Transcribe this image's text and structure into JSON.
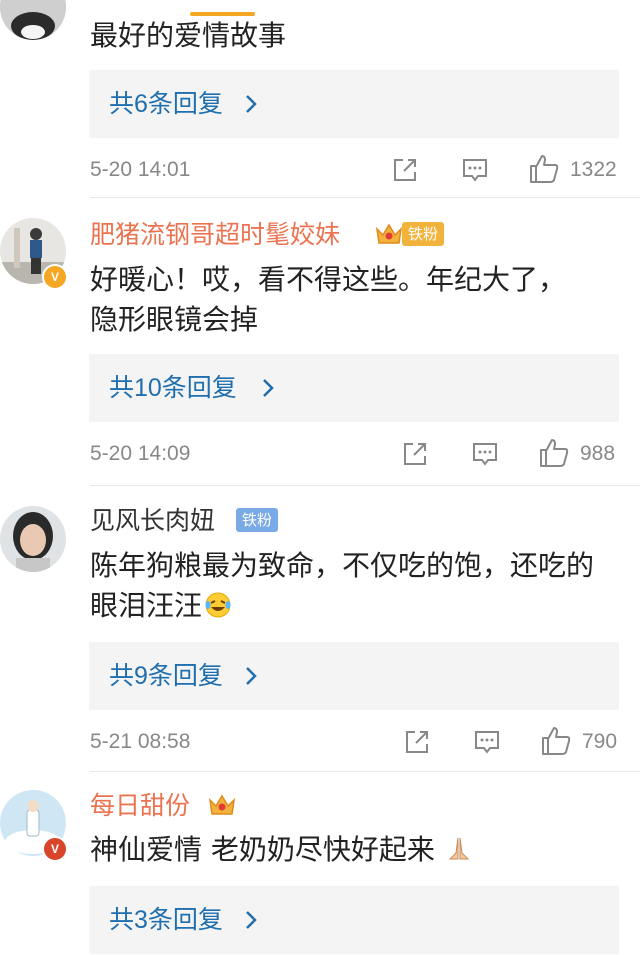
{
  "comments": [
    {
      "username": "",
      "text": "最好的爱情故事",
      "reply_label": "共6条回复",
      "time": "5-20 14:01",
      "likes": "1322"
    },
    {
      "username": "肥猪流钢哥超时髦姣妹",
      "badge": "铁粉",
      "text": "好暖心！哎，看不得这些。年纪大了，隐形眼镜会掉",
      "reply_label": "共10条回复",
      "time": "5-20 14:09",
      "likes": "988"
    },
    {
      "username": "见风长肉妞",
      "badge": "铁粉",
      "text": "陈年狗粮最为致命，不仅吃的饱，还吃的眼泪汪汪",
      "reply_label": "共9条回复",
      "time": "5-21 08:58",
      "likes": "790"
    },
    {
      "username": "每日甜份",
      "text": "神仙爱情 老奶奶尽快好起来",
      "reply_label": "共3条回复"
    }
  ],
  "colors": {
    "username_vip": "#eb7350",
    "link_blue": "#1f6ead",
    "meta_gray": "#888888",
    "reply_bg": "#f4f4f4",
    "verified_orange": "#f5a623",
    "verified_red": "#d9452b"
  },
  "icons": [
    "share-icon",
    "comment-icon",
    "like-icon",
    "chevron-right-icon",
    "crown-icon",
    "verified-icon",
    "crying-laughing-emoji",
    "pray-emoji"
  ]
}
